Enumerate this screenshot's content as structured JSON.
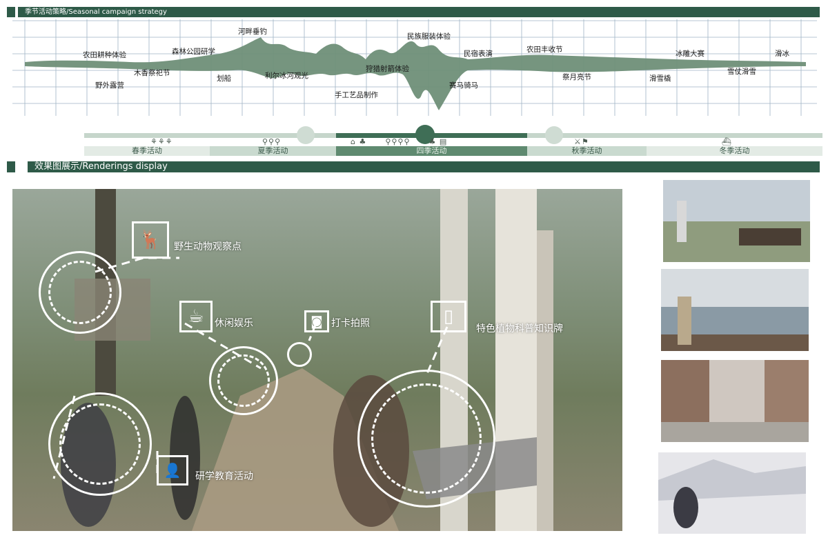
{
  "section1": {
    "title": "季节活动策略/Seasonal campaign strategy"
  },
  "section2": {
    "title": "效果图展示/Renderings display"
  },
  "timeline": {
    "events": [
      {
        "id": "e1",
        "label": "农田耕种体验"
      },
      {
        "id": "e2",
        "label": "野外露营"
      },
      {
        "id": "e3",
        "label": "森林公园研学"
      },
      {
        "id": "e4",
        "label": "木香祭祀节"
      },
      {
        "id": "e5",
        "label": "河畔垂钓"
      },
      {
        "id": "e6",
        "label": "划船"
      },
      {
        "id": "e7",
        "label": "利尔冰河观光"
      },
      {
        "id": "e8",
        "label": "狩猎射箭体验"
      },
      {
        "id": "e9",
        "label": "手工艺品制作"
      },
      {
        "id": "e10",
        "label": "民族服装体验"
      },
      {
        "id": "e11",
        "label": "民宿表演"
      },
      {
        "id": "e12",
        "label": "赛马骑马"
      },
      {
        "id": "e13",
        "label": "农田丰收节"
      },
      {
        "id": "e14",
        "label": "祭月亮节"
      },
      {
        "id": "e15",
        "label": "滑雪橇"
      },
      {
        "id": "e16",
        "label": "冰雕大赛"
      },
      {
        "id": "e17",
        "label": "雪仗滑雪"
      },
      {
        "id": "e18",
        "label": "滑冰"
      }
    ]
  },
  "seasons": [
    {
      "label": "春季活动",
      "icons": "⚘⚘⚘"
    },
    {
      "label": "夏季活动",
      "icons": "⚲⚲⚲"
    },
    {
      "label": "四季活动",
      "icons": "⌂ ♣      ⚲⚲⚲⚲      ♣ ▤"
    },
    {
      "label": "秋季活动",
      "icons": "⚔⚑"
    },
    {
      "label": "冬季活动",
      "icons": "⛴"
    }
  ],
  "callouts": [
    {
      "id": "wildlife",
      "label": "野生动物观察点",
      "icon_name": "deer-icon",
      "glyph": "🦌"
    },
    {
      "id": "leisure",
      "label": "休闲娱乐",
      "icon_name": "cup-icon",
      "glyph": "☕"
    },
    {
      "id": "photo",
      "label": "打卡拍照",
      "icon_name": "camera-icon",
      "glyph": "◙"
    },
    {
      "id": "plant",
      "label": "特色植物科普知识牌",
      "icon_name": "sign-board-icon",
      "glyph": "▯"
    },
    {
      "id": "edu",
      "label": "研学教育活动",
      "icon_name": "person-icon",
      "glyph": "👤"
    }
  ],
  "colors": {
    "brand_green": "#2e5a48",
    "wave_green": "#6f8f78",
    "season_light": "#dde7e0",
    "season_mid": "#b9cdbf",
    "season_dark": "#5f8a70"
  }
}
